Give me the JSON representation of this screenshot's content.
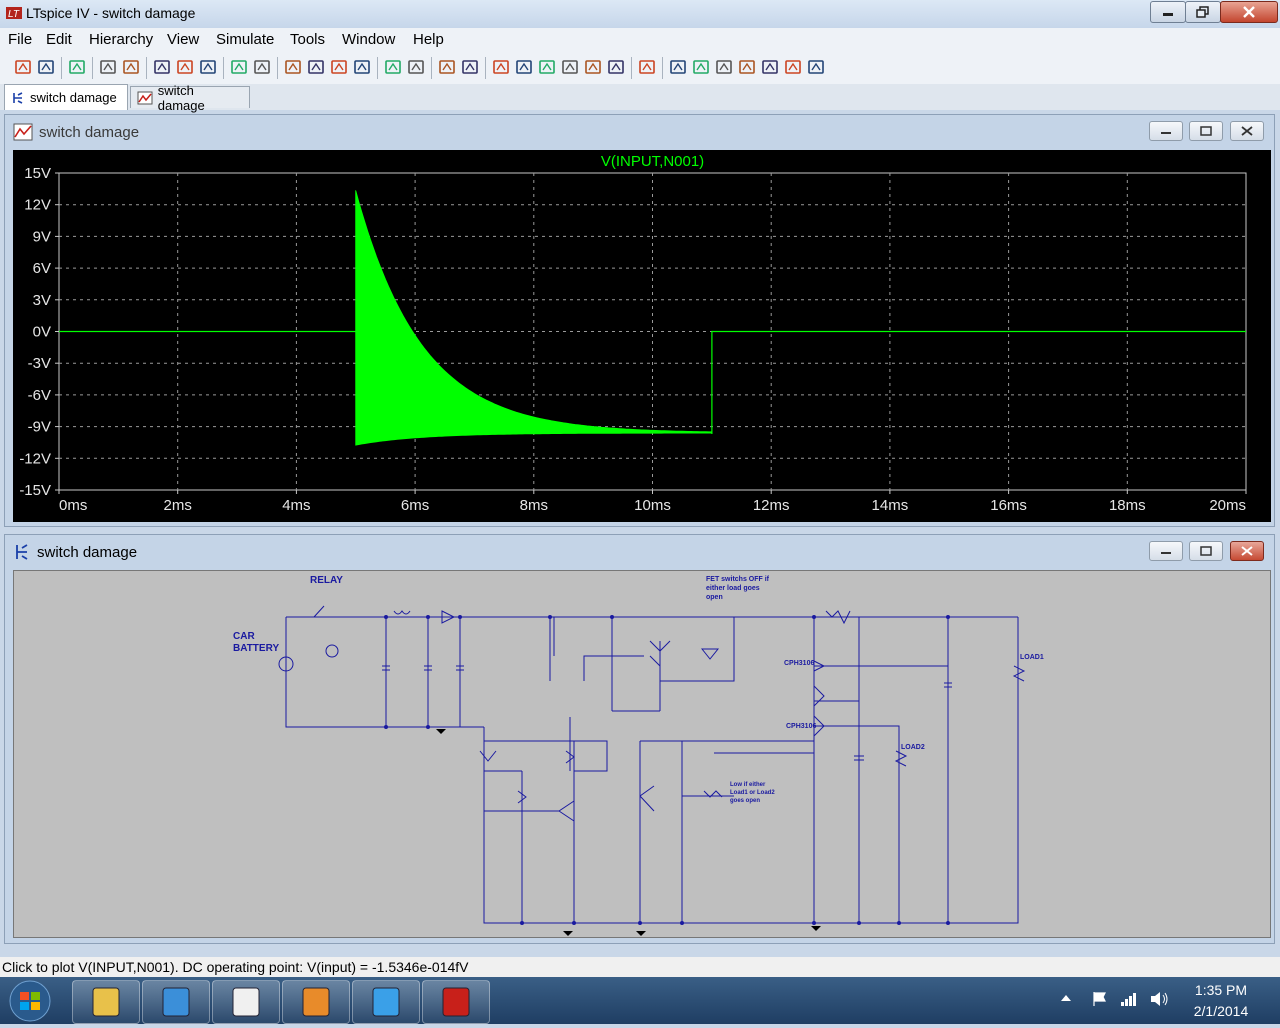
{
  "window": {
    "title": "LTspice IV - switch damage"
  },
  "menu": [
    "File",
    "Edit",
    "Hierarchy",
    "View",
    "Simulate",
    "Tools",
    "Window",
    "Help"
  ],
  "toolbar_icons": [
    "new-schematic-icon",
    "open-icon",
    "save-icon",
    "control-panel-icon",
    "run-icon",
    "pan-icon",
    "zoom-in-icon",
    "zoom-area-icon",
    "zoom-out-icon",
    "zoom-cancel-icon",
    "autoscale-icon",
    "grid-icon",
    "tile-horizontal-icon",
    "cascade-icon",
    "tile-vertical-icon",
    "cut-icon",
    "copy-icon",
    "paste-icon",
    "find-icon",
    "print-preview-icon",
    "print-icon",
    "wire-icon",
    "ground-icon",
    "label-icon",
    "resistor-icon",
    "capacitor-icon",
    "inductor-icon",
    "diode-icon",
    "component-icon",
    "move-icon",
    "drag-icon",
    "undo-icon",
    "redo-icon",
    "rotate-icon",
    "mirror-icon",
    "text-icon",
    "spice-directive-icon"
  ],
  "tabs": [
    {
      "label": "switch damage",
      "kind": "schematic"
    },
    {
      "label": "switch damage",
      "kind": "waveform"
    }
  ],
  "plot_window": {
    "title": "switch damage"
  },
  "schematic_window": {
    "title": "switch damage"
  },
  "chart_data": {
    "type": "line",
    "title": "V(INPUT,N001)",
    "xlabel": "",
    "ylabel": "",
    "x_ticks": [
      "0ms",
      "2ms",
      "4ms",
      "6ms",
      "8ms",
      "10ms",
      "12ms",
      "14ms",
      "16ms",
      "18ms",
      "20ms"
    ],
    "y_ticks": [
      "15V",
      "12V",
      "9V",
      "6V",
      "3V",
      "0V",
      "-3V",
      "-6V",
      "-9V",
      "-12V",
      "-15V"
    ],
    "xlim": [
      0,
      20
    ],
    "ylim": [
      -15,
      15
    ],
    "grid": true,
    "background": "#000000",
    "trace_color": "#00ff00",
    "series": [
      {
        "name": "V(INPUT,N001)",
        "segments": [
          {
            "kind": "line",
            "points": [
              [
                0,
                0
              ],
              [
                5,
                0
              ]
            ]
          },
          {
            "kind": "oscillation",
            "x_start": 5,
            "x_end": 11,
            "upper_start": 13.3,
            "lower_start": -13.4,
            "settle": -9.6
          },
          {
            "kind": "line",
            "points": [
              [
                11,
                -9.7
              ],
              [
                11,
                0
              ],
              [
                20,
                0
              ]
            ]
          }
        ]
      }
    ]
  },
  "schematic_labels": {
    "relay": "RELAY",
    "car_battery": [
      "CAR",
      "BATTERY"
    ],
    "fet_note": [
      "FET switchs OFF if",
      "either load goes",
      "open"
    ],
    "load1": "LOAD1",
    "load2": "LOAD2",
    "cph_top": "CPH3106",
    "cph_bottom": "CPH3106",
    "low_note": [
      "Low if either",
      "Load1 or Load2",
      "goes open"
    ]
  },
  "status": {
    "text": "Click to plot V(INPUT,N001).  DC operating point: V(input) = -1.5346e-014fV"
  },
  "taskbar": {
    "apps": [
      "windows-explorer-icon",
      "media-player-icon",
      "solitaire-icon",
      "outlook-icon",
      "internet-explorer-icon",
      "ltspice-icon"
    ],
    "time": "1:35 PM",
    "date": "2/1/2014"
  }
}
